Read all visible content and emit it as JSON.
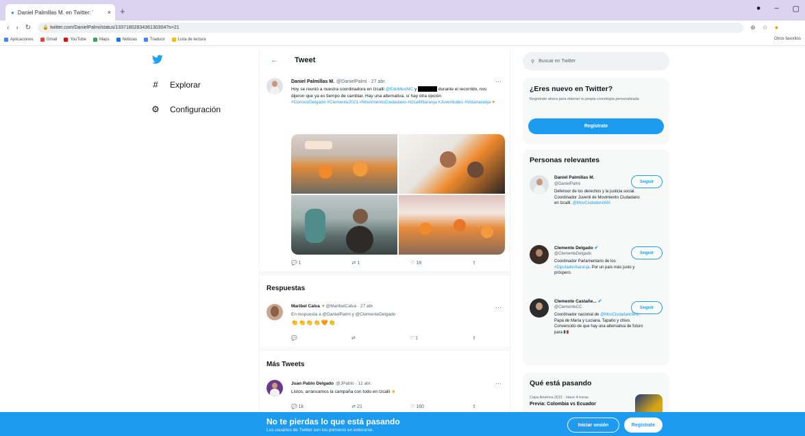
{
  "browser": {
    "tab_title": "Daniel Palmillas M. en Twitter: \"Hoy se...",
    "tab_close": "×",
    "new_tab": "+",
    "address": "twitter.com/DanielPalmi/status/1337180283436130304?s=21",
    "bookmarks": [
      {
        "label": "Aplicaciones",
        "color": "#4285f4"
      },
      {
        "label": "Gmail",
        "color": "#ea4335"
      },
      {
        "label": "YouTube",
        "color": "#ff0000"
      },
      {
        "label": "Maps",
        "color": "#34a853"
      },
      {
        "label": "Noticias",
        "color": "#1a73e8"
      },
      {
        "label": "Traducir",
        "color": "#4285f4"
      },
      {
        "label": "Lista de lectura",
        "color": "#fbbc05"
      }
    ],
    "bookmarks_right": "Otros favoritos"
  },
  "left_nav": {
    "items": [
      {
        "label": "Explorar",
        "icon": "#"
      },
      {
        "label": "Configuración",
        "icon": "⚙"
      }
    ]
  },
  "header": {
    "back": "←",
    "title": "Tweet"
  },
  "tweet": {
    "name": "Daniel Palmillas M.",
    "handle_time": "@DanielPalmi · 27 abr.",
    "more": "···",
    "text_1": "Hoy se reunió a nuestra coordinadora en Izcalli",
    "mention_1": "@EdoMexMC",
    "text_2": "y",
    "text_3": "durante el recorrido, nos dijeron que ya es tiempo de cambiar. Hay una alternativa, sí hay otra opción",
    "hashtags": "#ConoceDelgado #Clemente2021 #MovimientoCiudadano #IzcalliNaranja #Juventudes #Votanaranja",
    "counts": {
      "replies": "1",
      "retweets": "1",
      "likes": "18"
    }
  },
  "replies_section": {
    "title": "Respuestas",
    "reply": {
      "name": "Maribel Calva",
      "handle_time": "@MaribelCalva · 27 abr.",
      "text": "En respuesta a @DanielPalmi y @ClementeDelgado",
      "emojis": "👏👏👏👏🧡👏",
      "counts": {
        "replies": "",
        "retweets": "",
        "likes": "1"
      }
    }
  },
  "more_tweets": {
    "title": "Más Tweets",
    "tweet": {
      "name": "Juan Pablo Delgado",
      "handle_time": "@JPablo · 12 abr.",
      "text": "Listos, arrancamos la campaña con todo en Izcalli",
      "counts": {
        "replies": "1k",
        "retweets": "21",
        "likes": "160"
      }
    }
  },
  "search": {
    "placeholder": "Buscar en Twitter"
  },
  "new_card": {
    "title": "¿Eres nuevo en Twitter?",
    "subtitle": "Regístrate ahora para obtener tu propia cronología personalizada.",
    "button": "Regístrate"
  },
  "relevant": {
    "title": "Personas relevantes",
    "people": [
      {
        "name": "Daniel Palmillas M.",
        "handle": "@DanielPalmi",
        "bio": "Defensor de los derechos y la justicia social. Coordinador Juvenil de Movimiento Ciudadano en Izcalli.",
        "bio_link": "@MovCiudadanoMX",
        "follow": "Seguir",
        "verified": false
      },
      {
        "name": "Clemente Delgado",
        "handle": "@ClementeDelgado",
        "bio": "Coordinador Parlamentario de los",
        "bio_link": "#DiputadosNaranja",
        "bio_2": ". Por un país más justo y próspero.",
        "follow": "Seguir",
        "verified": true
      },
      {
        "name": "Clemente Castañe...",
        "handle": "@ClementeCC",
        "bio": "Coordinador nacional de",
        "bio_link": "@MovCiudadanoMX",
        "bio_2": ". Papá de María y Luciana. Tapatío y chivo. Convencido de que hay una alternativa de futuro para 🇲🇽",
        "follow": "Seguir",
        "verified": true
      }
    ]
  },
  "trending": {
    "title": "Qué está pasando",
    "meta": "Copa América 2021 · Hace 4 horas",
    "headline": "Previa: Colombia vs Ecuador"
  },
  "banner": {
    "title": "No te pierdas lo que está pasando",
    "subtitle": "Los usuarios de Twitter son los primeros en enterarse.",
    "login": "Iniciar sesión",
    "signup": "Regístrate"
  }
}
